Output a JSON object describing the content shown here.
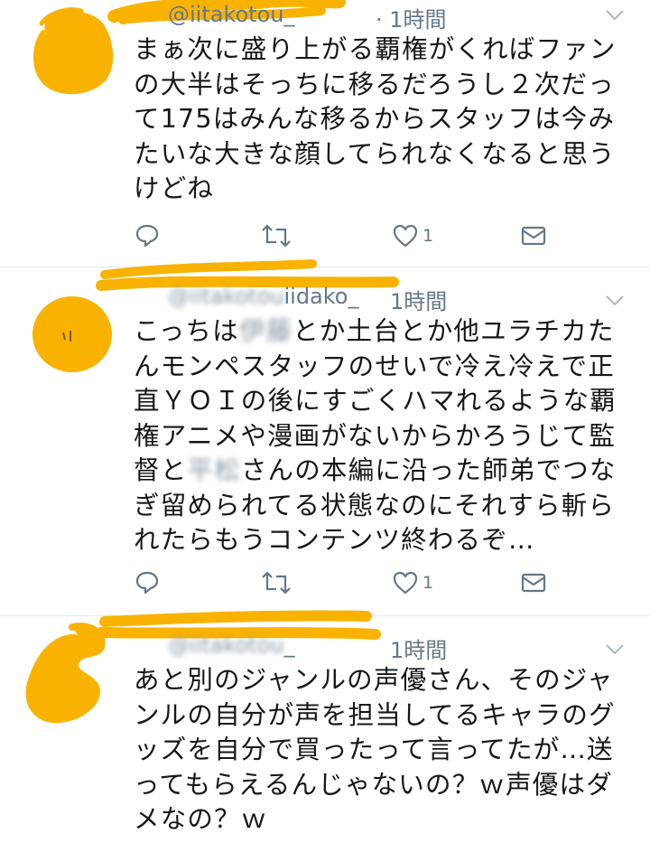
{
  "colors": {
    "scribble": "#f9b200",
    "muted": "#657786",
    "text": "#14171a",
    "divider": "#e1e8ed"
  },
  "tweets": [
    {
      "handle": "@iitakotou",
      "handle_suffix": "_",
      "time": "· 1時間",
      "text": "まぁ次に盛り上がる覇権がくればファンの大半はそっちに移るだろうし２次だって175はみんな移るからスタッフは今みたいな大きな顔してられなくなると思うけどね",
      "like_count": "1",
      "icons": [
        "reply-icon",
        "retweet-icon",
        "like-icon",
        "dm-icon"
      ]
    },
    {
      "handle": "@iitakotou",
      "handle_suffix": "iidako_",
      "time": "1時間",
      "text_before_1": "こっちは",
      "redacted_1": "伊藤",
      "text_middle": "とか土台とか他ユラチカたんモンペスタッフのせいで冷え冷えで正直ＹＯＩの後にすごくハマれるような覇権アニメや漫画がないからかろうじて監督と",
      "redacted_2": "平松",
      "text_after_2": "さんの本編に沿った師弟でつなぎ留められてる状態なのにそれすら斬られたらもうコンテンツ終わるぞ…",
      "like_count": "1",
      "icons": [
        "reply-icon",
        "retweet-icon",
        "like-icon",
        "dm-icon"
      ]
    },
    {
      "handle": "@iitakotou",
      "handle_suffix": "_",
      "time": "1時間",
      "text": "あと別のジャンルの声優さん、そのジャンルの自分が声を担当してるキャラのグッズを自分で買ったって言ってたが…送ってもらえるんじゃないの？ｗ声優はダメなの？ｗ"
    }
  ]
}
